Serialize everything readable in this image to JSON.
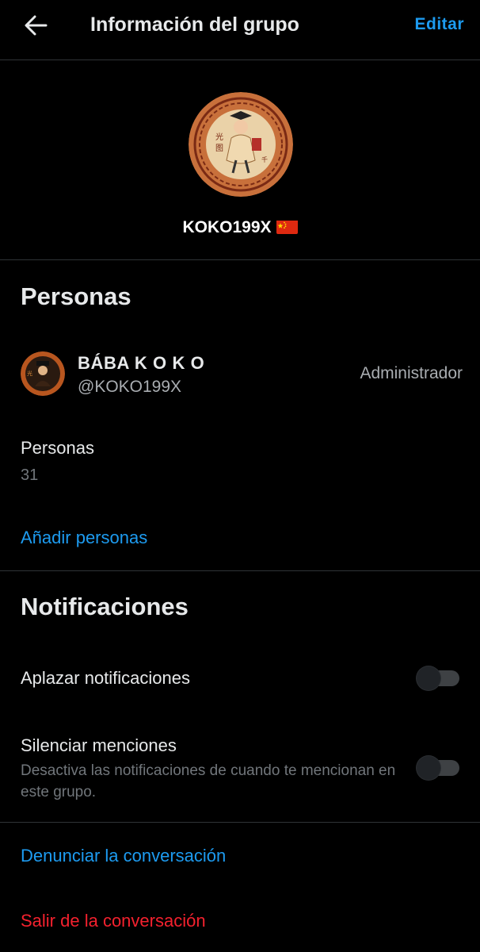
{
  "header": {
    "back_icon": "arrow-left-icon",
    "title": "Información del grupo",
    "edit_label": "Editar"
  },
  "group": {
    "name": "KOKO199X",
    "flag_icon": "china-flag-icon",
    "avatar_icon": "group-avatar-emblem"
  },
  "people": {
    "section_title": "Personas",
    "members": [
      {
        "name": "BÁBA K O K O",
        "handle": "@KOKO199X",
        "role": "Administrador"
      }
    ],
    "count_label": "Personas",
    "count_value": "31",
    "add_label": "Añadir personas"
  },
  "notifications": {
    "section_title": "Notificaciones",
    "snooze": {
      "label": "Aplazar notificaciones",
      "enabled": false
    },
    "mute_mentions": {
      "label": "Silenciar menciones",
      "description": "Desactiva las notificaciones de cuando te mencionan en este grupo.",
      "enabled": false
    }
  },
  "actions": {
    "report_label": "Denunciar la conversación",
    "leave_label": "Salir de la conversación"
  },
  "colors": {
    "background": "#000000",
    "accent_blue": "#1d9bf0",
    "danger_red": "#f4212e",
    "divider": "#2f3336",
    "secondary_text": "#71767b"
  }
}
